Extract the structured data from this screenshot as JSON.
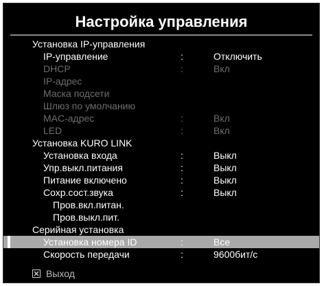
{
  "title": "Настройка управления",
  "rows": [
    {
      "label": "Установка IP-управления",
      "value": "",
      "level": 0,
      "state": "normal"
    },
    {
      "label": "IP-управление",
      "value": "Отключить",
      "level": 1,
      "state": "normal"
    },
    {
      "label": "DHCP",
      "value": "Вкл",
      "level": 1,
      "state": "dim"
    },
    {
      "label": "IP-адрес",
      "value": "",
      "level": 1,
      "state": "dim"
    },
    {
      "label": "Маска подсети",
      "value": "",
      "level": 1,
      "state": "dim"
    },
    {
      "label": "Шлюз по умолчанию",
      "value": "",
      "level": 1,
      "state": "dim"
    },
    {
      "label": "MAC-адрес",
      "value": "Вкл",
      "level": 1,
      "state": "dim"
    },
    {
      "label": "LED",
      "value": "Вкл",
      "level": 1,
      "state": "dim"
    },
    {
      "label": "Установка KURO LINK",
      "value": "",
      "level": 0,
      "state": "normal"
    },
    {
      "label": "Установка входа",
      "value": "Выкл",
      "level": 1,
      "state": "normal"
    },
    {
      "label": "Упр.выкл.питания",
      "value": "Выкл",
      "level": 1,
      "state": "normal"
    },
    {
      "label": "Питание включено",
      "value": "Выкл",
      "level": 1,
      "state": "normal"
    },
    {
      "label": "Сохр.сост.звука",
      "value": "Выкл",
      "level": 1,
      "state": "normal"
    },
    {
      "label": "Пров.вкл.питан.",
      "value": "",
      "level": 2,
      "state": "normal"
    },
    {
      "label": "Пров.выкл.пит.",
      "value": "",
      "level": 2,
      "state": "normal"
    },
    {
      "label": "Серийная установка",
      "value": "",
      "level": 0,
      "state": "normal"
    },
    {
      "label": "Установка номера ID",
      "value": "Все",
      "level": 1,
      "state": "selected"
    },
    {
      "label": "Скорость передачи",
      "value": "9600бит/с",
      "level": 1,
      "state": "normal"
    }
  ],
  "colon": ":",
  "exit": {
    "label": "Выход",
    "icon": "close-box-icon"
  },
  "colors": {
    "background": "#000000",
    "text": "#ffffff",
    "dim": "#6e6e6e",
    "highlight": "#a9a9a9"
  }
}
